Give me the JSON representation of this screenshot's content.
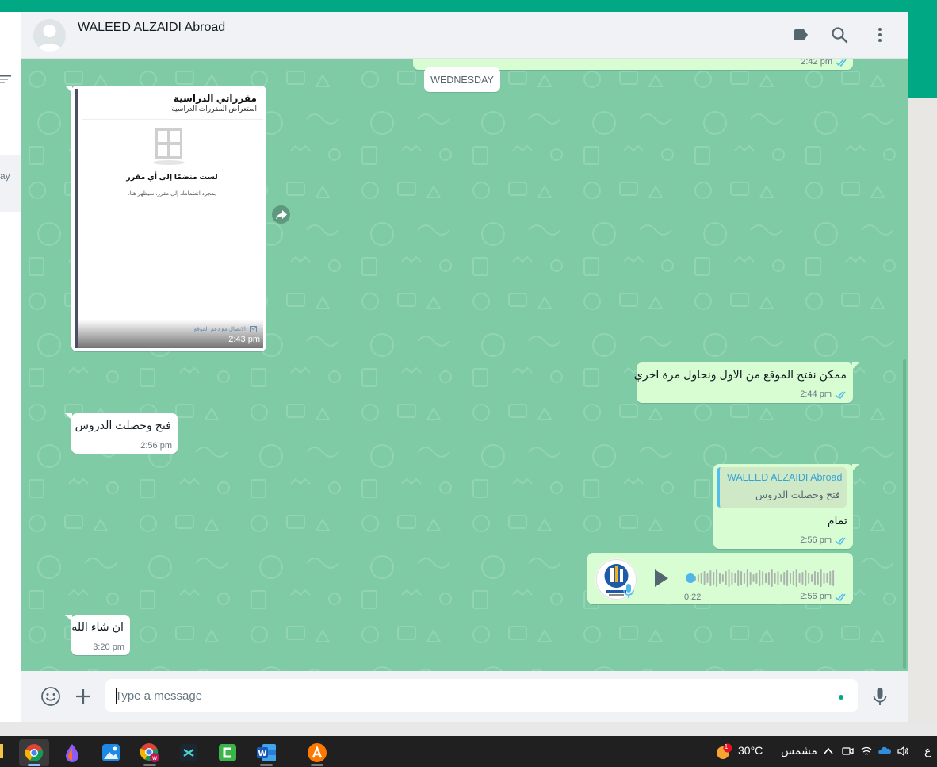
{
  "window": {
    "accent_color": "#00a884",
    "chat_bg_color": "#7ecba6",
    "outgoing_color": "#d9fdd3",
    "incoming_color": "#ffffff"
  },
  "sidebar": {
    "filter_icon": "filter-icon",
    "selected_item_partial": "ay"
  },
  "header": {
    "contact_name": "WALEED ALZAIDI Abroad",
    "icons": [
      "label-icon",
      "search-icon",
      "menu-icon"
    ]
  },
  "messages": {
    "top_partial_time": "2:42 pm",
    "date_divider": "WEDNESDAY",
    "image_message": {
      "title": "مقرراتي الدراسية",
      "subtitle": "استعراض المقررات الدراسية",
      "empty_title": "لست منضمًا إلى أي مقرر",
      "empty_subtitle": "بمجرد انضمامك إلى مقرر، سيظهر هنا.",
      "support_link": "الاتصال مع دعم الموقع",
      "time": "2:43 pm"
    },
    "msg_out_1": {
      "text": "ممكن نفتح الموقع من الاول ونحاول مرة اخري",
      "time": "2:44 pm"
    },
    "msg_in_1": {
      "text": "فتح وحصلت الدروس",
      "time": "2:56 pm"
    },
    "msg_out_reply": {
      "quote_name": "WALEED ALZAIDI Abroad",
      "quote_text": "فتح وحصلت الدروس",
      "text": "تمام",
      "time": "2:56 pm"
    },
    "voice_msg": {
      "duration": "0:22",
      "time": "2:56 pm",
      "progress": 0
    },
    "msg_in_2": {
      "text": "ان شاء الله",
      "time": "3:20 pm"
    }
  },
  "footer": {
    "placeholder": "Type a message",
    "icons": [
      "emoji-icon",
      "plus-icon",
      "mic-icon"
    ]
  },
  "taskbar": {
    "apps": [
      "chrome-icon",
      "paint-drop-icon",
      "photos-icon",
      "chrome-profile-icon",
      "capcut-icon",
      "camtasia-icon",
      "word-icon",
      "avast-icon"
    ],
    "weather_temp": "30°C",
    "weather_desc": "مشمس",
    "weather_badge": "1",
    "language": "ع"
  }
}
